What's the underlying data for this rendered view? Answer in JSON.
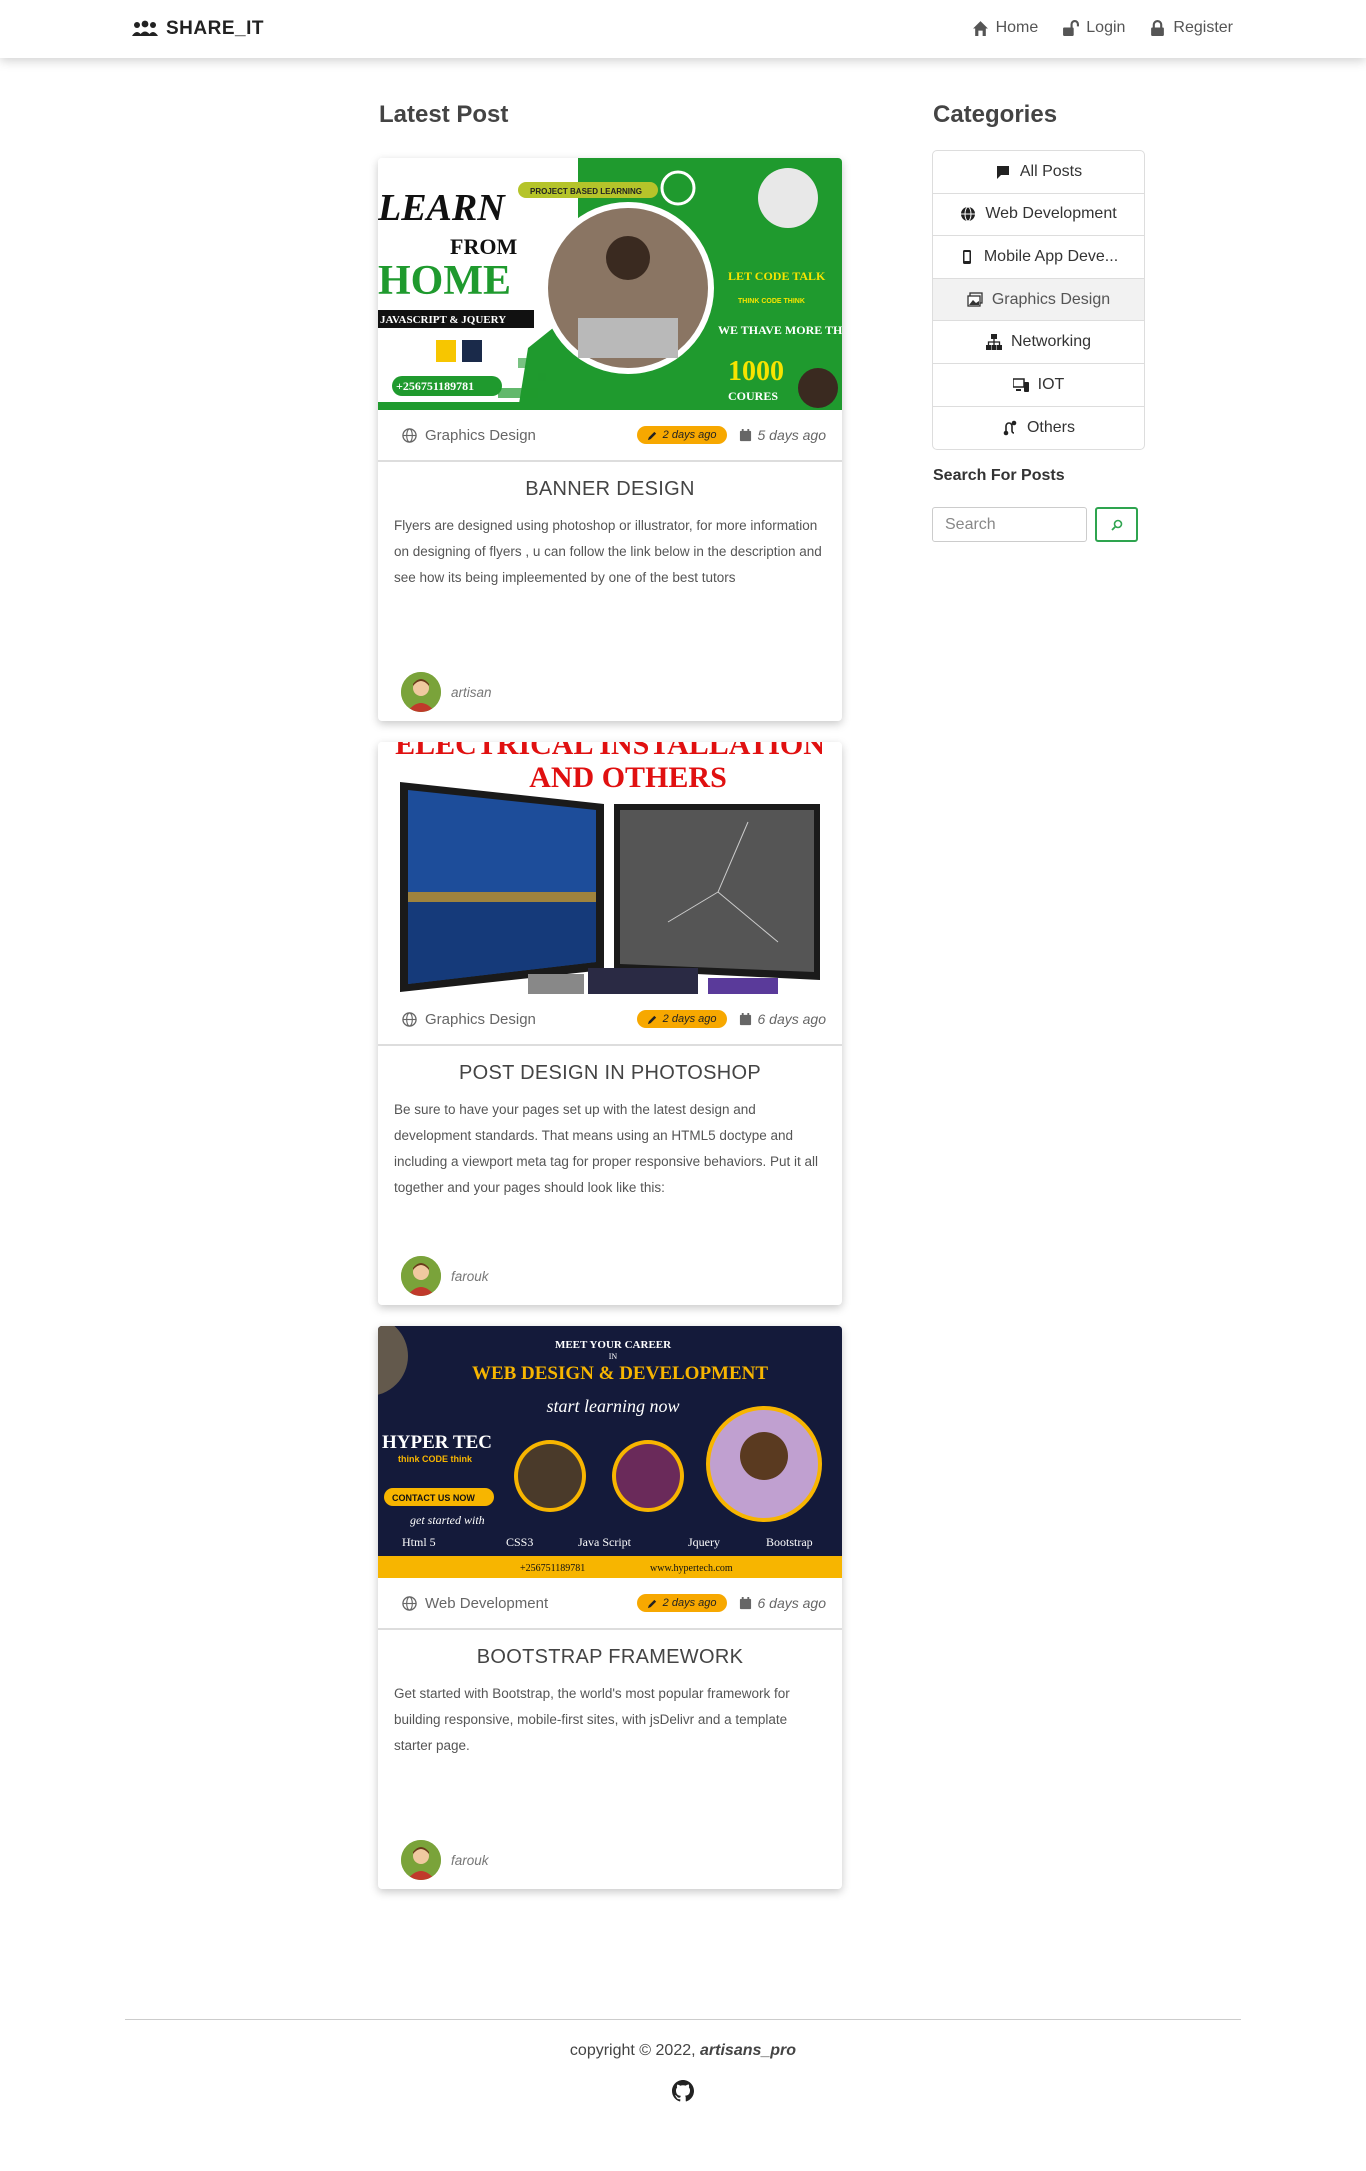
{
  "navbar": {
    "brand": "SHARE_IT",
    "links": [
      {
        "label": "Home",
        "icon": "home-icon"
      },
      {
        "label": "Login",
        "icon": "unlock-icon"
      },
      {
        "label": "Register",
        "icon": "lock-icon"
      }
    ]
  },
  "main": {
    "title": "Latest Post",
    "posts": [
      {
        "category": "Graphics Design",
        "badge": "2 days ago",
        "date": "5 days ago",
        "title": "BANNER DESIGN",
        "body": "Flyers are designed using photoshop or illustrator, for more information on designing of flyers , u can follow the link below in the description and see how its being impleemented by one of the best tutors",
        "author": "artisan",
        "image": {
          "tag": "PROJECT BASED LEARNING",
          "line1": "LEARN",
          "line2": "FROM",
          "line3": "HOME",
          "line4": "JAVASCRIPT & JQUERY",
          "phone": "+256751189781",
          "right1": "LET CODE TALK",
          "right2": "THINK CODE THINK",
          "right3": "WE THAVE MORE THAN",
          "right4": "1000",
          "right5": "COURES"
        }
      },
      {
        "category": "Graphics Design",
        "badge": "2 days ago",
        "date": "6 days ago",
        "title": "POST DESIGN IN PHOTOSHOP",
        "body": "Be sure to have your pages set up with the latest design and development standards. That means using an HTML5 doctype and including a viewport meta tag for proper responsive behaviors. Put it all together and your pages should look like this:",
        "author": "farouk",
        "image": {
          "line1": "ELECTRICAL INSTALLATION",
          "line2": "AND OTHERS"
        }
      },
      {
        "category": "Web Development",
        "badge": "2 days ago",
        "date": "6 days ago",
        "title": "BOOTSTRAP FRAMEWORK",
        "body": "Get started with Bootstrap, the world's most popular framework for building responsive, mobile-first sites, with jsDelivr and a template starter page.",
        "author": "farouk",
        "image": {
          "top1": "MEET YOUR CAREER",
          "top2": "IN",
          "headline": "WEB DESIGN & DEVELOPMENT",
          "script": "start learning now",
          "brand": "HYPER TEC",
          "brand_sub": "think CODE think",
          "contact": "CONTACT US NOW",
          "started": "get started with",
          "techs": [
            "Html 5",
            "CSS3",
            "Java Script",
            "Jquery",
            "Bootstrap"
          ],
          "phone": "+256751189781",
          "site": "www.hypertech.com"
        }
      }
    ]
  },
  "sidebar": {
    "title": "Categories",
    "categories": [
      {
        "label": "All Posts",
        "icon": "chat-icon"
      },
      {
        "label": "Web Development",
        "icon": "globe-icon"
      },
      {
        "label": "Mobile App Deve...",
        "icon": "phone-icon"
      },
      {
        "label": "Graphics Design",
        "icon": "images-icon"
      },
      {
        "label": "Networking",
        "icon": "network-icon"
      },
      {
        "label": "IOT",
        "icon": "devices-icon"
      },
      {
        "label": "Others",
        "icon": "route-icon"
      }
    ],
    "search_label": "Search For Posts",
    "search_placeholder": "Search"
  },
  "footer": {
    "copyright_prefix": "copyright © 2022,",
    "copyright_name": "artisans_pro"
  },
  "colors": {
    "badge": "#f7a800",
    "search_button_border": "#2ea44f",
    "banner_green": "#1f9a2e"
  }
}
